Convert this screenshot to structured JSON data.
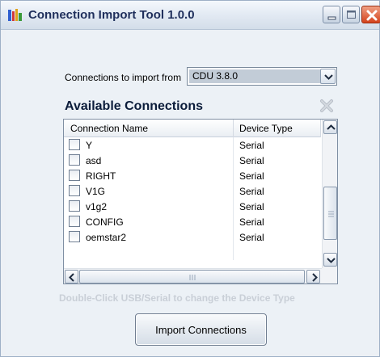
{
  "window": {
    "title": "Connection Import Tool 1.0.0",
    "icon": "app-icon",
    "controls": [
      "minimize-icon",
      "maximize-icon",
      "close-icon"
    ]
  },
  "import_source": {
    "label": "Connections to import from",
    "selected": "CDU 3.8.0"
  },
  "available": {
    "title": "Available Connections",
    "clear_icon": "clear-x-icon"
  },
  "grid": {
    "columns": [
      "Connection Name",
      "Device Type"
    ],
    "rows": [
      {
        "name": "Y",
        "type": "Serial",
        "checked": false
      },
      {
        "name": "asd",
        "type": "Serial",
        "checked": false
      },
      {
        "name": "RIGHT",
        "type": "Serial",
        "checked": false
      },
      {
        "name": "V1G",
        "type": "Serial",
        "checked": false
      },
      {
        "name": "v1g2",
        "type": "Serial",
        "checked": false
      },
      {
        "name": "CONFIG",
        "type": "Serial",
        "checked": false
      },
      {
        "name": "oemstar2",
        "type": "Serial",
        "checked": false
      }
    ]
  },
  "hint": "Double-Click USB/Serial to change the Device Type",
  "actions": {
    "import_label": "Import Connections"
  },
  "colors": {
    "title_text": "#1f2f5c",
    "hint_text": "#c9cfd7",
    "close_button": "#d4421c"
  }
}
